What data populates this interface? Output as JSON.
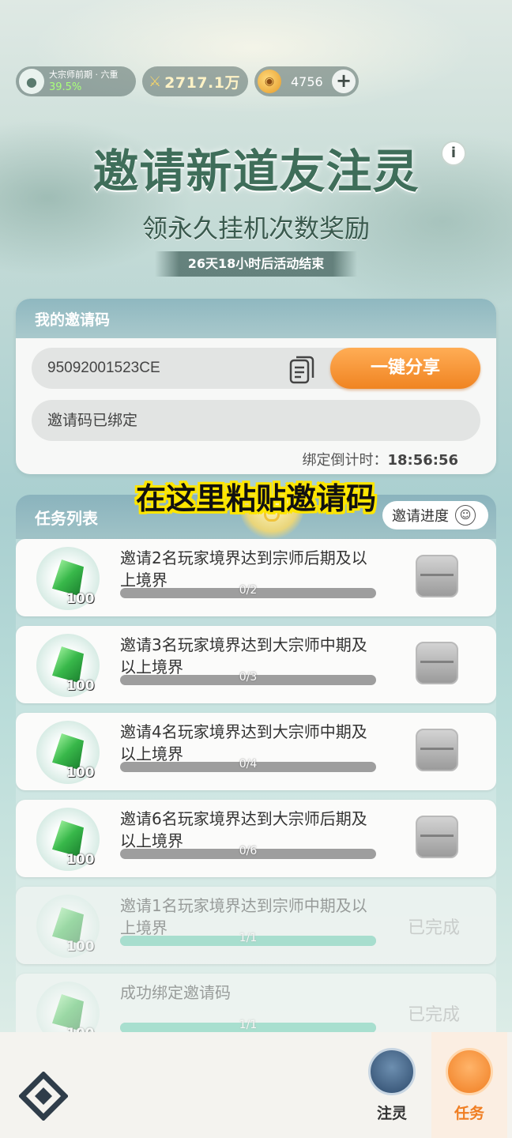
{
  "status": {
    "realm_name": "大宗师前期 · 六重",
    "realm_progress": "39.5%",
    "power": "2717.1万",
    "coins": "4756",
    "plus": "+"
  },
  "header": {
    "title": "邀请新道友注灵",
    "info": "i",
    "subtitle": "领永久挂机次数奖励",
    "countdown": "26天18小时后活动结束"
  },
  "invite": {
    "section_title": "我的邀请码",
    "code": "95092001523CE",
    "share_label": "一键分享",
    "bound_text": "邀请码已绑定",
    "timer_label": "绑定倒计时：",
    "timer_value": "18:56:56"
  },
  "caption": "在这里粘贴邀请码",
  "tasks_section": {
    "title": "任务列表",
    "progress_button": "邀请进度",
    "tasks": [
      {
        "title": "邀请2名玩家境界达到宗师后期及以上境界",
        "progress_text": "0/2",
        "progress": 0,
        "reward": "100",
        "status": "pending"
      },
      {
        "title": "邀请3名玩家境界达到大宗师中期及以上境界",
        "progress_text": "0/3",
        "progress": 0,
        "reward": "100",
        "status": "pending"
      },
      {
        "title": "邀请4名玩家境界达到大宗师中期及以上境界",
        "progress_text": "0/4",
        "progress": 0,
        "reward": "100",
        "status": "pending"
      },
      {
        "title": "邀请6名玩家境界达到大宗师后期及以上境界",
        "progress_text": "0/6",
        "progress": 0,
        "reward": "100",
        "status": "pending"
      },
      {
        "title": "邀请1名玩家境界达到宗师中期及以上境界",
        "progress_text": "1/1",
        "progress": 1,
        "reward": "100",
        "status": "已完成"
      },
      {
        "title": "成功绑定邀请码",
        "progress_text": "1/1",
        "progress": 1,
        "reward": "100",
        "status": "已完成"
      }
    ]
  },
  "nav": {
    "zhuling": "注灵",
    "task": "任务"
  },
  "colors": {
    "accent_orange": "#f08422",
    "progress_green": "#56c8a8",
    "title_green": "#3f6e5a"
  }
}
